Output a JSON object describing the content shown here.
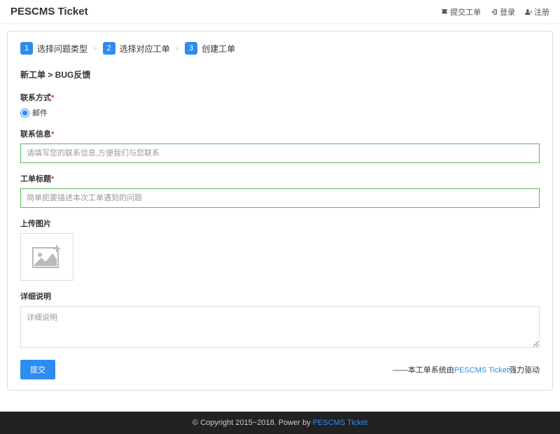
{
  "nav": {
    "brand": "PESCMS Ticket",
    "submit_ticket": "提交工单",
    "login": "登录",
    "register": "注册"
  },
  "steps": [
    {
      "num": "1",
      "label": "选择问题类型"
    },
    {
      "num": "2",
      "label": "选择对应工单"
    },
    {
      "num": "3",
      "label": "创建工单"
    }
  ],
  "step_sep": "»",
  "breadcrumb": "新工单 > BUG反馈",
  "form": {
    "contact_method_label": "联系方式",
    "contact_method_option": "邮件",
    "contact_info_label": "联系信息",
    "contact_info_placeholder": "请填写您的联系信息,方便我们与您联系",
    "title_label": "工单标题",
    "title_placeholder": "简单扼要描述本次工单遇到的问题",
    "upload_label": "上传图片",
    "detail_label": "详细说明",
    "detail_placeholder": "详细说明",
    "submit": "提交",
    "required_mark": "*"
  },
  "credit": {
    "prefix": "——本工单系统由",
    "link": "PESCMS Ticket",
    "suffix": "强力驱动"
  },
  "footer": {
    "text": "© Copyright 2015~2018. Power by ",
    "link": "PESCMS Ticket"
  }
}
